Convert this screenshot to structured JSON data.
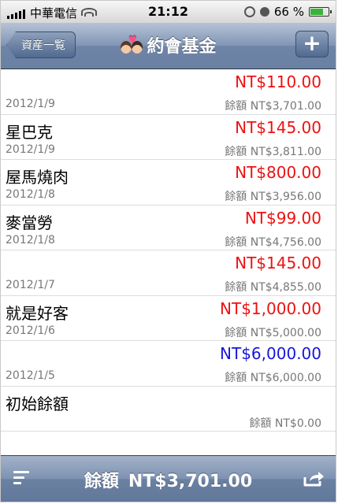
{
  "status_bar": {
    "carrier": "中華電信",
    "time": "21:12",
    "battery_percent": "66 %",
    "battery_level": 0.66
  },
  "nav": {
    "back_label": "資産一覧",
    "title": "約會基金",
    "add_label": "+"
  },
  "transactions": [
    {
      "name": "",
      "amount": "NT$110.00",
      "amount_color": "#ee1111",
      "date": "2012/1/9",
      "balance": "餘額 NT$3,701.00"
    },
    {
      "name": "星巴克",
      "amount": "NT$145.00",
      "amount_color": "#ee1111",
      "date": "2012/1/9",
      "balance": "餘額 NT$3,811.00"
    },
    {
      "name": "屋馬燒肉",
      "amount": "NT$800.00",
      "amount_color": "#ee1111",
      "date": "2012/1/8",
      "balance": "餘額 NT$3,956.00"
    },
    {
      "name": "麥當勞",
      "amount": "NT$99.00",
      "amount_color": "#ee1111",
      "date": "2012/1/8",
      "balance": "餘額 NT$4,756.00"
    },
    {
      "name": "",
      "amount": "NT$145.00",
      "amount_color": "#ee1111",
      "date": "2012/1/7",
      "balance": "餘額 NT$4,855.00"
    },
    {
      "name": "就是好客",
      "amount": "NT$1,000.00",
      "amount_color": "#ee1111",
      "date": "2012/1/6",
      "balance": "餘額 NT$5,000.00"
    },
    {
      "name": "",
      "amount": "NT$6,000.00",
      "amount_color": "#1616dd",
      "date": "2012/1/5",
      "balance": "餘額 NT$6,000.00"
    },
    {
      "name": "初始餘額",
      "amount": "",
      "amount_color": "#000000",
      "date": "",
      "balance": "餘額 NT$0.00"
    }
  ],
  "footer": {
    "balance_label": "餘額",
    "balance_value": "NT$3,701.00"
  },
  "icons": {
    "menu": "list-menu-icon",
    "share": "share-icon",
    "title_emoji": "couple-icon"
  }
}
